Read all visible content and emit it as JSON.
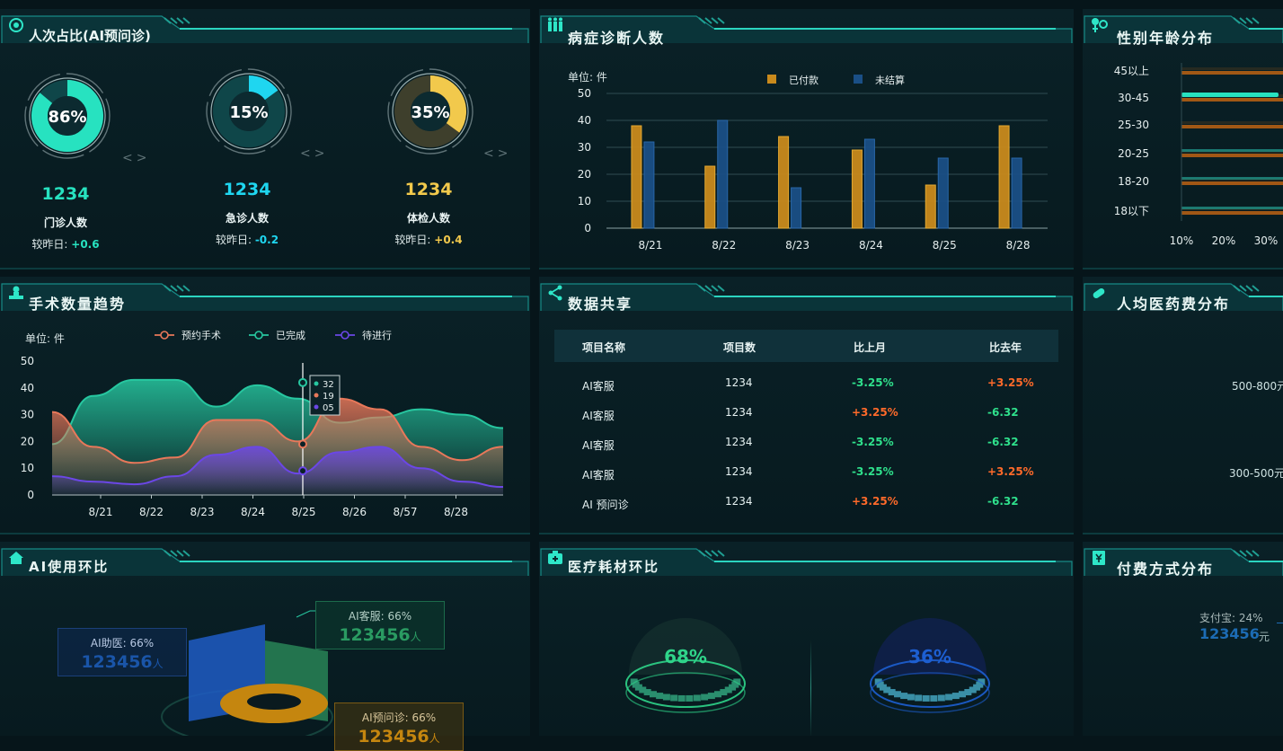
{
  "panels": {
    "p1": {
      "title": "人次占比(AI预问诊)"
    },
    "p2": {
      "title": "病症诊断人数"
    },
    "p3": {
      "title": "性别年龄分布"
    },
    "p4": {
      "title": "手术数量趋势"
    },
    "p5": {
      "title": "数据共享"
    },
    "p6": {
      "title": "人均医药费分布"
    },
    "p7": {
      "title": "AI使用环比"
    },
    "p8": {
      "title": "医疗耗材环比"
    },
    "p9": {
      "title": "付费方式分布"
    }
  },
  "rings": [
    {
      "percent": 86,
      "percent_text": "86%",
      "count": "1234",
      "label": "门诊人数",
      "delta_label": "较昨日:",
      "delta": "+0.6",
      "color": "#27e2c0",
      "nav": "<>"
    },
    {
      "percent": 15,
      "percent_text": "15%",
      "count": "1234",
      "label": "急诊人数",
      "delta_label": "较昨日:",
      "delta": "-0.2",
      "color": "#1fd6f0",
      "nav": "<>"
    },
    {
      "percent": 35,
      "percent_text": "35%",
      "count": "1234",
      "label": "体检人数",
      "delta_label": "较昨日:",
      "delta": "+0.4",
      "color": "#f2c94c",
      "nav": "<>"
    }
  ],
  "chart_data": [
    {
      "type": "bar",
      "unit_label": "单位: 件",
      "categories": [
        "8/21",
        "8/22",
        "8/23",
        "8/24",
        "8/25",
        "8/28"
      ],
      "series": [
        {
          "name": "已付款",
          "values": [
            38,
            23,
            34,
            29,
            16,
            38
          ],
          "color": "#c98a1c"
        },
        {
          "name": "未结算",
          "values": [
            32,
            40,
            15,
            33,
            26,
            26
          ],
          "color": "#1a4f86"
        }
      ],
      "ylim": [
        0,
        50
      ],
      "yticks": [
        0,
        10,
        20,
        30,
        40,
        50
      ],
      "grid": true,
      "legend": "top-center"
    },
    {
      "type": "area",
      "unit_label": "单位: 件",
      "categories": [
        "8/21",
        "8/22",
        "8/23",
        "8/24",
        "8/25",
        "8/26",
        "8/57",
        "8/28"
      ],
      "series": [
        {
          "name": "预约手术",
          "values": [
            31,
            18,
            12,
            14,
            28,
            28,
            20,
            36,
            32,
            18,
            13,
            18
          ],
          "color": "#e8785a"
        },
        {
          "name": "已完成",
          "values": [
            19,
            37,
            43,
            43,
            33,
            41,
            36,
            27,
            29,
            32,
            30,
            25
          ],
          "color": "#27c7a0"
        },
        {
          "name": "待进行",
          "values": [
            7,
            5,
            4,
            7,
            15,
            18,
            8,
            16,
            18,
            10,
            5,
            3
          ],
          "color": "#6b47e6"
        }
      ],
      "ylim": [
        0,
        50
      ],
      "yticks": [
        0,
        10,
        20,
        30,
        40,
        50
      ],
      "tooltip": {
        "category": "8/25",
        "values": [
          "32",
          "19",
          "05"
        ]
      },
      "legend": "top"
    },
    {
      "type": "bar",
      "orientation": "horizontal",
      "categories": [
        "45以上",
        "30-45",
        "25-30",
        "20-25",
        "18-20",
        "18以下"
      ],
      "series": [
        {
          "name": "",
          "values": [
            35,
            33,
            35,
            38,
            36,
            37
          ],
          "color": "#c96a16"
        },
        {
          "name": "",
          "values": [
            0,
            27,
            0,
            0,
            0,
            0
          ],
          "color": "#27e2c0"
        }
      ],
      "xticks": [
        "10%",
        "20%",
        "30%"
      ]
    }
  ],
  "table": {
    "headers": [
      "项目名称",
      "项目数",
      "比上月",
      "比去年"
    ],
    "rows": [
      {
        "name": "AI客服",
        "count": "1234",
        "mom": "-3.25%",
        "mom_dir": "neg",
        "yoy": "+3.25%",
        "yoy_dir": "pos"
      },
      {
        "name": "AI客服",
        "count": "1234",
        "mom": "+3.25%",
        "mom_dir": "pos",
        "yoy": "-6.32",
        "yoy_dir": "neg"
      },
      {
        "name": "AI客服",
        "count": "1234",
        "mom": "-3.25%",
        "mom_dir": "neg",
        "yoy": "-6.32",
        "yoy_dir": "neg"
      },
      {
        "name": "AI客服",
        "count": "1234",
        "mom": "-3.25%",
        "mom_dir": "neg",
        "yoy": "+3.25%",
        "yoy_dir": "pos"
      },
      {
        "name": "AI 预问诊",
        "count": "1234",
        "mom": "+3.25%",
        "mom_dir": "pos",
        "yoy": "-6.32",
        "yoy_dir": "neg"
      }
    ]
  },
  "med_cost": {
    "labels": [
      "500-800元",
      "300-500元"
    ]
  },
  "ai_usage": {
    "tags": [
      {
        "label": "AI助医: 66%",
        "value": "123456",
        "unit": "人"
      },
      {
        "label": "AI客服: 66%",
        "value": "123456",
        "unit": "人"
      },
      {
        "label": "AI预问诊: 66%",
        "value": "123456",
        "unit": "人"
      }
    ]
  },
  "consumables": {
    "domes": [
      {
        "percent_text": "68%",
        "color": "#2fd58a"
      },
      {
        "percent_text": "36%",
        "color": "#1d5fd1"
      }
    ]
  },
  "payment": {
    "label": "支付宝: 24%",
    "value": "123456",
    "unit": "元"
  }
}
